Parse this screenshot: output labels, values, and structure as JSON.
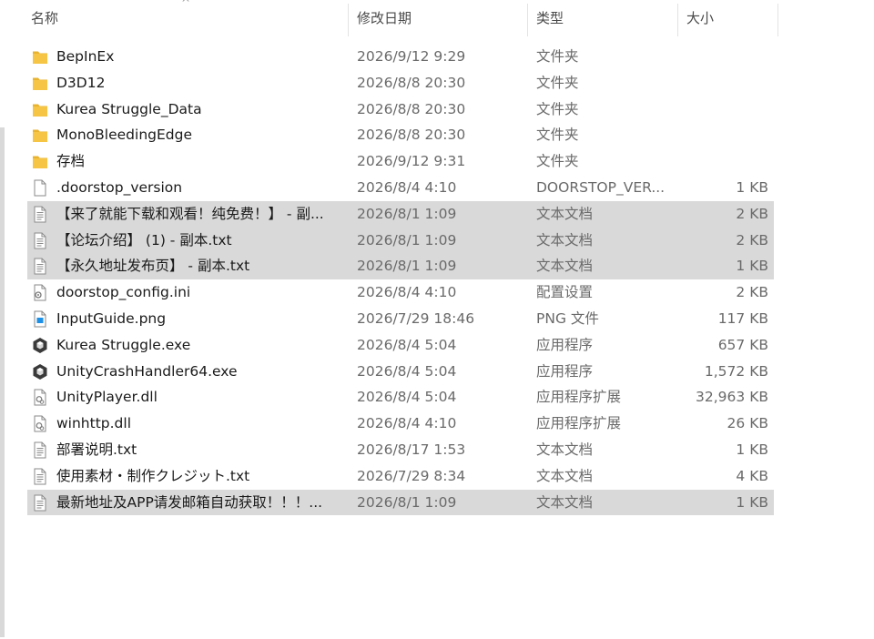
{
  "header": {
    "name": "名称",
    "date": "修改日期",
    "type": "类型",
    "size": "大小"
  },
  "colors": {
    "folder": "#f6c545",
    "selected_row": "#d9d9d9",
    "secondary_text": "#6a6a6a"
  },
  "files": [
    {
      "name": "BepInEx",
      "date": "2026/9/12 9:29",
      "type": "文件夹",
      "size": "",
      "icon": "folder-icon",
      "selected": false
    },
    {
      "name": "D3D12",
      "date": "2026/8/8 20:30",
      "type": "文件夹",
      "size": "",
      "icon": "folder-icon",
      "selected": false
    },
    {
      "name": "Kurea Struggle_Data",
      "date": "2026/8/8 20:30",
      "type": "文件夹",
      "size": "",
      "icon": "folder-icon",
      "selected": false
    },
    {
      "name": "MonoBleedingEdge",
      "date": "2026/8/8 20:30",
      "type": "文件夹",
      "size": "",
      "icon": "folder-icon",
      "selected": false
    },
    {
      "name": "存档",
      "date": "2026/9/12 9:31",
      "type": "文件夹",
      "size": "",
      "icon": "folder-icon",
      "selected": false
    },
    {
      "name": ".doorstop_version",
      "date": "2026/8/4 4:10",
      "type": "DOORSTOP_VER...",
      "size": "1 KB",
      "icon": "blank-file-icon",
      "selected": false
    },
    {
      "name": "【来了就能下载和观看！纯免费！】 - 副...",
      "date": "2026/8/1 1:09",
      "type": "文本文档",
      "size": "2 KB",
      "icon": "text-file-icon",
      "selected": true
    },
    {
      "name": "【论坛介绍】 (1) - 副本.txt",
      "date": "2026/8/1 1:09",
      "type": "文本文档",
      "size": "2 KB",
      "icon": "text-file-icon",
      "selected": true
    },
    {
      "name": "【永久地址发布页】 - 副本.txt",
      "date": "2026/8/1 1:09",
      "type": "文本文档",
      "size": "1 KB",
      "icon": "text-file-icon",
      "selected": true
    },
    {
      "name": "doorstop_config.ini",
      "date": "2026/8/4 4:10",
      "type": "配置设置",
      "size": "2 KB",
      "icon": "config-file-icon",
      "selected": false
    },
    {
      "name": "InputGuide.png",
      "date": "2026/7/29 18:46",
      "type": "PNG 文件",
      "size": "117 KB",
      "icon": "image-file-icon",
      "selected": false
    },
    {
      "name": "Kurea Struggle.exe",
      "date": "2026/8/4 5:04",
      "type": "应用程序",
      "size": "657 KB",
      "icon": "unity-app-icon",
      "selected": false
    },
    {
      "name": "UnityCrashHandler64.exe",
      "date": "2026/8/4 5:04",
      "type": "应用程序",
      "size": "1,572 KB",
      "icon": "unity-app-icon",
      "selected": false
    },
    {
      "name": "UnityPlayer.dll",
      "date": "2026/8/4 5:04",
      "type": "应用程序扩展",
      "size": "32,963 KB",
      "icon": "dll-file-icon",
      "selected": false
    },
    {
      "name": "winhttp.dll",
      "date": "2026/8/4 4:10",
      "type": "应用程序扩展",
      "size": "26 KB",
      "icon": "dll-file-icon",
      "selected": false
    },
    {
      "name": "部署说明.txt",
      "date": "2026/8/17 1:53",
      "type": "文本文档",
      "size": "1 KB",
      "icon": "text-file-icon",
      "selected": false
    },
    {
      "name": "使用素材・制作クレジット.txt",
      "date": "2026/7/29 8:34",
      "type": "文本文档",
      "size": "4 KB",
      "icon": "text-file-icon",
      "selected": false
    },
    {
      "name": "最新地址及APP请发邮箱自动获取！！！...",
      "date": "2026/8/1 1:09",
      "type": "文本文档",
      "size": "1 KB",
      "icon": "text-file-icon",
      "selected": true
    }
  ]
}
